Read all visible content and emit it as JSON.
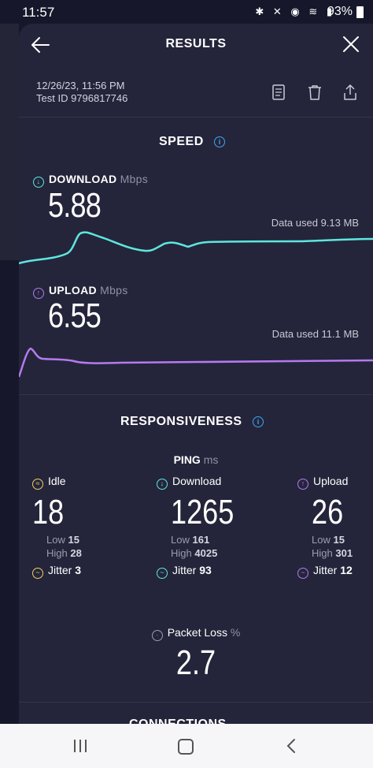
{
  "status_bar": {
    "time": "11:57",
    "battery": "93%"
  },
  "header": {
    "title": "RESULTS"
  },
  "meta": {
    "date": "12/26/23, 11:56 PM",
    "test_id": "Test ID 9796817746"
  },
  "speed": {
    "title": "SPEED",
    "download": {
      "label": "DOWNLOAD",
      "unit": "Mbps",
      "value": "5.88",
      "data_used": "Data used 9.13 MB"
    },
    "upload": {
      "label": "UPLOAD",
      "unit": "Mbps",
      "value": "6.55",
      "data_used": "Data used 11.1 MB"
    }
  },
  "responsiveness": {
    "title": "RESPONSIVENESS",
    "ping_label": "PING",
    "ping_unit": "ms",
    "idle": {
      "label": "Idle",
      "value": "18",
      "low_label": "Low",
      "low": "15",
      "high_label": "High",
      "high": "28",
      "jitter_label": "Jitter",
      "jitter": "3"
    },
    "download": {
      "label": "Download",
      "value": "1265",
      "low_label": "Low",
      "low": "161",
      "high_label": "High",
      "high": "4025",
      "jitter_label": "Jitter",
      "jitter": "93"
    },
    "upload": {
      "label": "Upload",
      "value": "26",
      "low_label": "Low",
      "low": "15",
      "high_label": "High",
      "high": "301",
      "jitter_label": "Jitter",
      "jitter": "12"
    },
    "packet_loss": {
      "label": "Packet Loss",
      "unit": "%",
      "value": "2.7"
    }
  },
  "next_section": "CONNECTIONS",
  "colors": {
    "download": "#5ee6e0",
    "upload": "#b57af0",
    "idle": "#f0d060",
    "info": "#3ea6f0",
    "card": "#24253a"
  }
}
